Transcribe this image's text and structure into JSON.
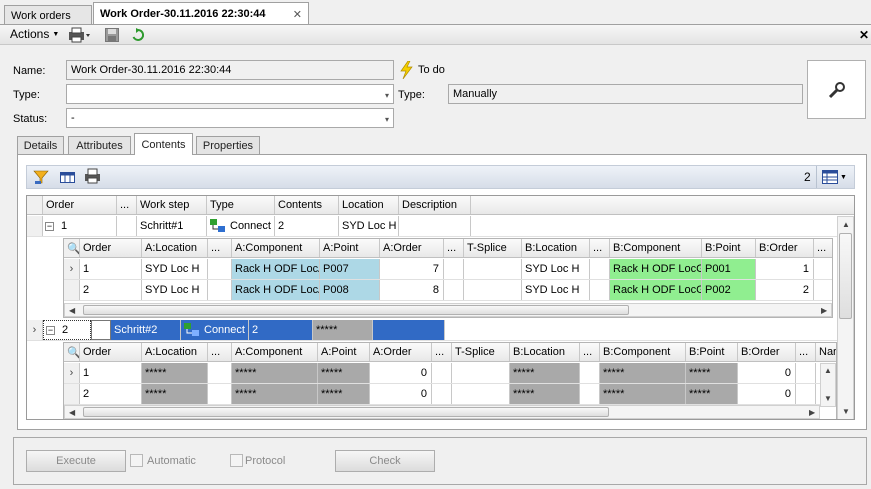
{
  "tabs": {
    "work_orders": "Work orders",
    "current": "Work Order-30.11.2016 22:30:44",
    "close": "✕"
  },
  "toolbar": {
    "actions": "Actions",
    "close": "✕"
  },
  "form": {
    "name_label": "Name:",
    "name_value": "Work Order-30.11.2016 22:30:44",
    "status_flag": "To do",
    "type_label": "Type:",
    "type_value": "",
    "type2_label": "Type:",
    "type2_value": "Manually",
    "status_label": "Status:",
    "status_value": "-"
  },
  "subtabs": [
    "Details",
    "Attributes",
    "Contents",
    "Properties"
  ],
  "grid_toolbar": {
    "count": "2"
  },
  "main_grid": {
    "headers": [
      "Order",
      "...",
      "Work step",
      "Type",
      "Contents",
      "Location",
      "Description"
    ],
    "rows": [
      {
        "order": "1",
        "step": "Schritt#1",
        "type": "Connect",
        "contents": "2",
        "location": "SYD Loc H",
        "description": ""
      },
      {
        "order": "2",
        "step": "Schritt#2",
        "type": "Connect",
        "contents": "2",
        "location": "*****",
        "description": ""
      }
    ]
  },
  "detail1": {
    "headers": [
      "Order",
      "A:Location",
      "...",
      "A:Component",
      "A:Point",
      "A:Order",
      "...",
      "T-Splice",
      "B:Location",
      "...",
      "B:Component",
      "B:Point",
      "B:Order",
      "..."
    ],
    "rows": [
      {
        "order": "1",
        "aloc": "SYD Loc H",
        "acomp": "Rack H ODF LocA",
        "apoint": "P007",
        "aorder": "7",
        "tsplice": "",
        "bloc": "SYD Loc H",
        "bcomp": "Rack H ODF LocG",
        "bpoint": "P001",
        "border": "1"
      },
      {
        "order": "2",
        "aloc": "SYD Loc H",
        "acomp": "Rack H ODF LocA",
        "apoint": "P008",
        "aorder": "8",
        "tsplice": "",
        "bloc": "SYD Loc H",
        "bcomp": "Rack H ODF LocG",
        "bpoint": "P002",
        "border": "2"
      }
    ]
  },
  "detail2": {
    "headers": [
      "Order",
      "A:Location",
      "...",
      "A:Component",
      "A:Point",
      "A:Order",
      "...",
      "T-Splice",
      "B:Location",
      "...",
      "B:Component",
      "B:Point",
      "B:Order",
      "...",
      "Nar"
    ],
    "rows": [
      {
        "order": "1",
        "aloc": "*****",
        "acomp": "*****",
        "apoint": "*****",
        "aorder": "0",
        "tsplice": "",
        "bloc": "*****",
        "bcomp": "*****",
        "bpoint": "*****",
        "border": "0"
      },
      {
        "order": "2",
        "aloc": "*****",
        "acomp": "*****",
        "apoint": "*****",
        "aorder": "0",
        "tsplice": "",
        "bloc": "*****",
        "bcomp": "*****",
        "bpoint": "*****",
        "border": "0"
      }
    ]
  },
  "bottom": {
    "execute": "Execute",
    "automatic": "Automatic",
    "protocol": "Protocol",
    "check": "Check"
  },
  "colors": {
    "selection": "#316ac5",
    "cyan": "#add8e6",
    "green": "#90ee90",
    "masked": "#a9a9a9"
  }
}
